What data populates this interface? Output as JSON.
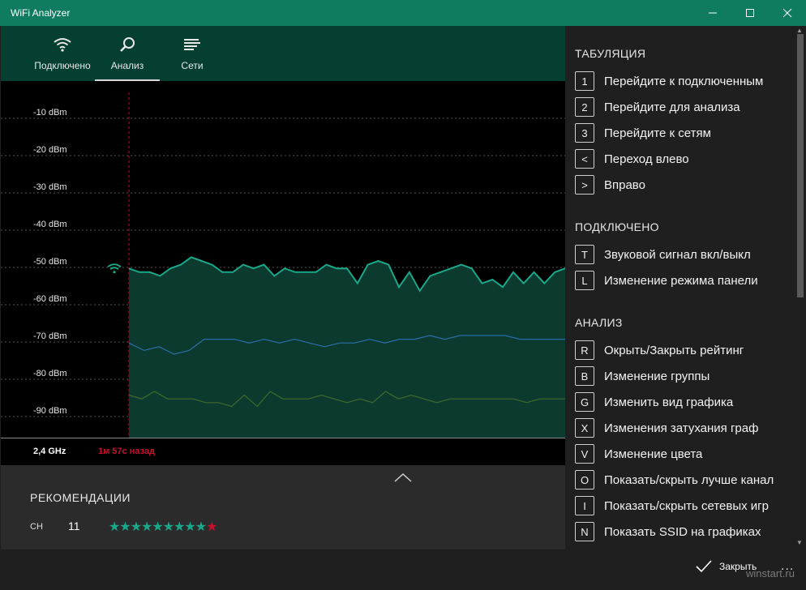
{
  "window": {
    "title": "WiFi Analyzer",
    "minimize_icon": "minimize-icon",
    "maximize_icon": "maximize-icon",
    "close_icon": "close-icon"
  },
  "nav": {
    "tabs": [
      {
        "label": "Подключено",
        "icon": "wifi-icon",
        "active": false
      },
      {
        "label": "Анализ",
        "icon": "magnifier-icon",
        "active": true
      },
      {
        "label": "Сети",
        "icon": "list-icon",
        "active": false
      }
    ]
  },
  "chart": {
    "y_labels": [
      "-10 dBm",
      "-20 dBm",
      "-30 dBm",
      "-40 dBm",
      "-50 dBm",
      "-60 dBm",
      "-70 dBm",
      "-80 dBm",
      "-90 dBm"
    ],
    "frequency": "2,4 GHz",
    "time_ago": "1м 57с назад",
    "connected_icon": "wifi-icon"
  },
  "chart_data": {
    "type": "line",
    "ylabel": "",
    "ylim": [
      -100,
      -5
    ],
    "series": [
      {
        "color": "#1aa88a",
        "fill": true,
        "values": [
          -52,
          -53,
          -53,
          -54,
          -52,
          -51,
          -49,
          -50,
          -51,
          -53,
          -53,
          -51,
          -52,
          -51,
          -54,
          -52,
          -53,
          -53,
          -53,
          -51,
          -52,
          -52,
          -56,
          -51,
          -50,
          -51,
          -57,
          -53,
          -58,
          -54,
          -53,
          -52,
          -51,
          -52,
          -56,
          -55,
          -57,
          -53,
          -56,
          -53,
          -56,
          -53,
          -52
        ]
      },
      {
        "color": "#2a6fa8",
        "fill": false,
        "values": [
          -72,
          -74,
          -73,
          -75,
          -74,
          -71,
          -71,
          -71,
          -72,
          -71,
          -72,
          -71,
          -72,
          -73,
          -72,
          -72,
          -71,
          -72,
          -71,
          -71,
          -70,
          -71,
          -70,
          -70,
          -70,
          -70,
          -71,
          -71,
          -71,
          -71
        ]
      },
      {
        "color": "#3f6b2a",
        "fill": false,
        "values": [
          -86,
          -87,
          -85,
          -87,
          -87,
          -87,
          -88,
          -88,
          -89,
          -86,
          -89,
          -85,
          -87,
          -87,
          -87,
          -86,
          -87,
          -88,
          -87,
          -88,
          -85,
          -87,
          -86,
          -87,
          -88,
          -87,
          -87,
          -87,
          -87,
          -87,
          -87,
          -88,
          -87,
          -87,
          -87
        ]
      }
    ]
  },
  "recommendations": {
    "title": "РЕКОМЕНДАЦИИ",
    "channel_label": "CH",
    "channel_value": "11",
    "rating": 9,
    "rating_max": 10,
    "chevron_icon": "chevron-up-icon"
  },
  "panel": {
    "sections": [
      {
        "title": "ТАБУЛЯЦИЯ",
        "items": [
          {
            "key": "1",
            "label": "Перейдите к подключенным"
          },
          {
            "key": "2",
            "label": "Перейдите для анализа"
          },
          {
            "key": "3",
            "label": "Перейдите к сетям"
          },
          {
            "key": "<",
            "label": "Переход влево"
          },
          {
            "key": ">",
            "label": "Вправо"
          }
        ]
      },
      {
        "title": "ПОДКЛЮЧЕНО",
        "items": [
          {
            "key": "T",
            "label": "Звуковой сигнал вкл/выкл"
          },
          {
            "key": "L",
            "label": "Изменение режима панели"
          }
        ]
      },
      {
        "title": "АНАЛИЗ",
        "items": [
          {
            "key": "R",
            "label": "Окрыть/Закрыть рейтинг"
          },
          {
            "key": "B",
            "label": "Изменение группы"
          },
          {
            "key": "G",
            "label": "Изменить вид графика"
          },
          {
            "key": "X",
            "label": "Изменения затухания граф"
          },
          {
            "key": "V",
            "label": "Изменение цвета"
          },
          {
            "key": "O",
            "label": "Показать/скрыть лучше канал"
          },
          {
            "key": "I",
            "label": "Показать/скрыть сетевых игр"
          },
          {
            "key": "N",
            "label": "Показать SSID на графиках"
          }
        ]
      }
    ]
  },
  "footer": {
    "close_label": "Закрыть",
    "close_icon": "checkmark-icon",
    "more_label": "...",
    "watermark": "winstart.ru"
  }
}
